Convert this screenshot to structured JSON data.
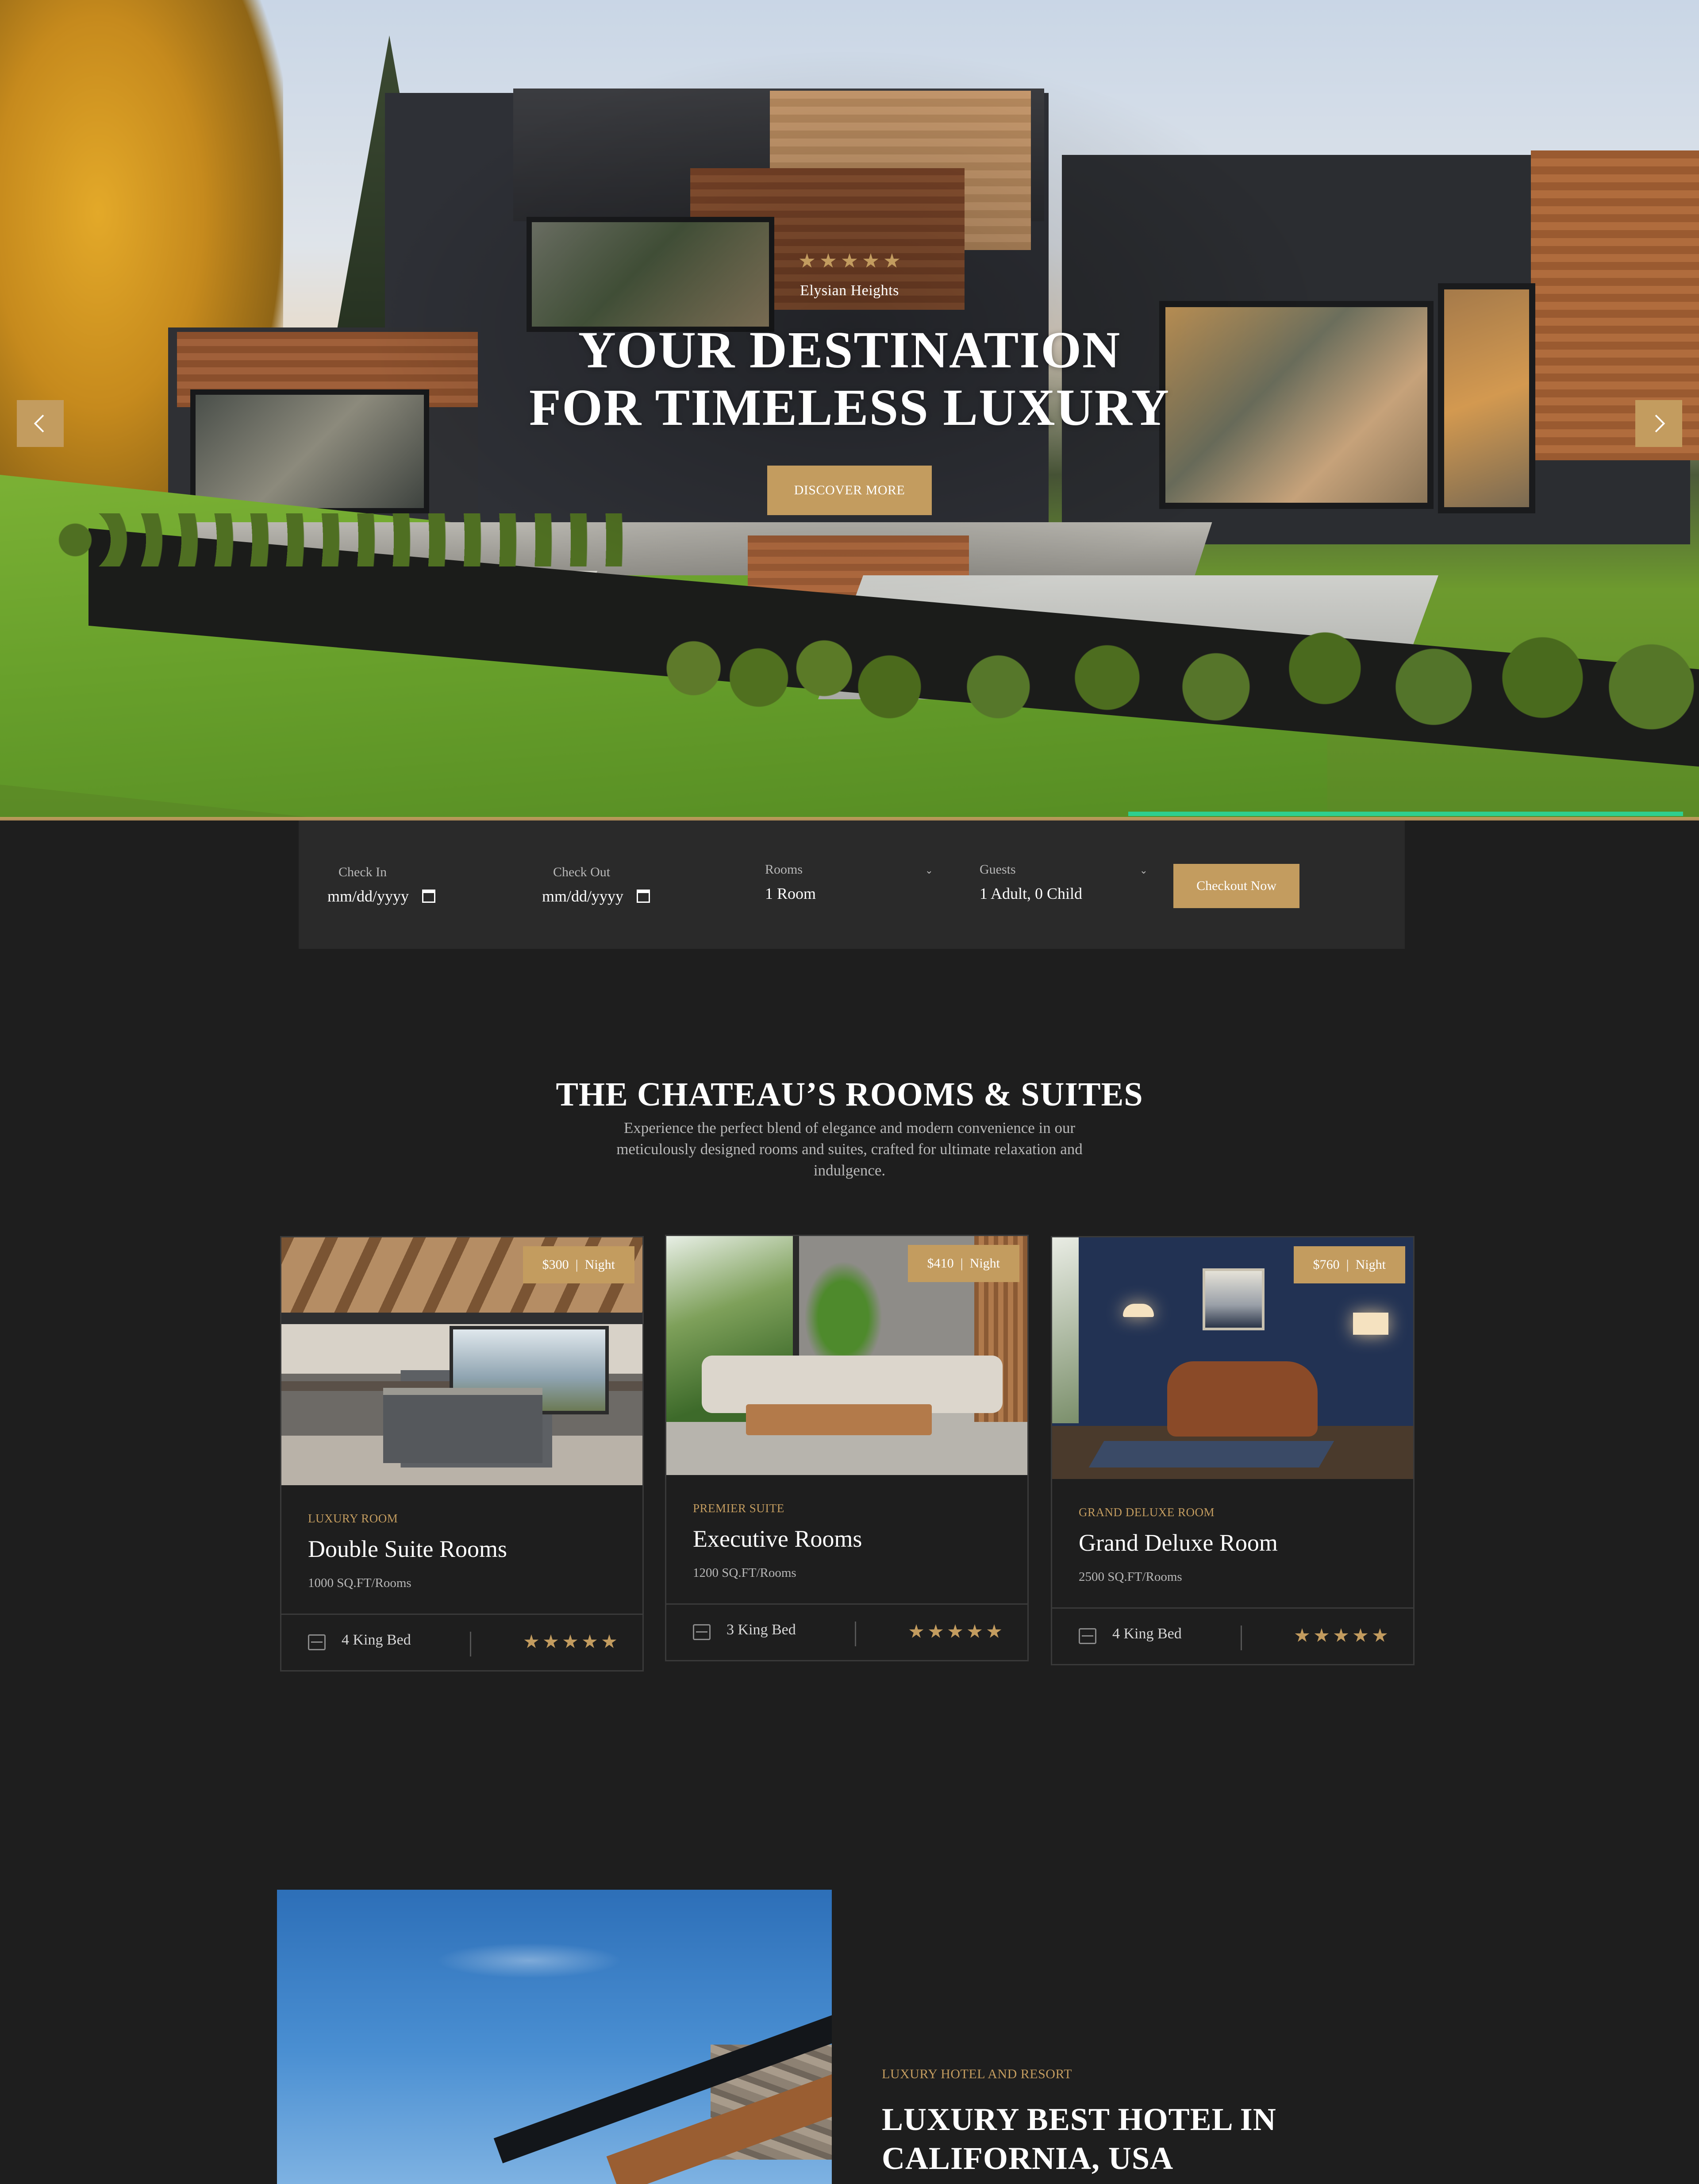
{
  "hero": {
    "rating_stars": 5,
    "brand": "Elysian Heights",
    "title_line1": "YOUR DESTINATION",
    "title_line2": "FOR TIMELESS LUXURY",
    "cta_label": "DISCOVER MORE",
    "prev_icon": "chevron-left-icon",
    "next_icon": "chevron-right-icon",
    "slide_progress": 0.33
  },
  "booking": {
    "check_in": {
      "label": "Check In",
      "value": "mm/dd/yyyy"
    },
    "check_out": {
      "label": "Check Out",
      "value": "mm/dd/yyyy"
    },
    "rooms": {
      "label": "Rooms",
      "value": "1 Room"
    },
    "guests": {
      "label": "Guests",
      "value": "1 Adult, 0 Child"
    },
    "submit_label": "Checkout Now"
  },
  "rooms_section": {
    "title": "THE CHATEAU’S ROOMS & SUITES",
    "description": "Experience the perfect blend of elegance and modern convenience in our meticulously designed rooms and suites, crafted for ultimate relaxation and indulgence.",
    "cards": [
      {
        "price": "$300  |  Night",
        "category": "LUXURY ROOM",
        "name": "Double Suite Rooms",
        "size": "1000 SQ.FT/Rooms",
        "beds": "4 King Bed",
        "stars": 5
      },
      {
        "price": "$410  |  Night",
        "category": "PREMIER SUITE",
        "name": "Executive Rooms",
        "size": "1200 SQ.FT/Rooms",
        "beds": "3 King Bed",
        "stars": 5
      },
      {
        "price": "$760  |  Night",
        "category": "GRAND DELUXE ROOM",
        "name": "Grand Deluxe Room",
        "size": "2500 SQ.FT/Rooms",
        "beds": "4 King Bed",
        "stars": 5
      }
    ]
  },
  "about": {
    "kicker": "LUXURY HOTEL AND RESORT",
    "title": "LUXURY BEST HOTEL IN CALIFORNIA, USA"
  },
  "colors": {
    "accent_gold": "#c39c5f",
    "background": "#1e1e1e",
    "progress_green": "#2ecf8f"
  }
}
